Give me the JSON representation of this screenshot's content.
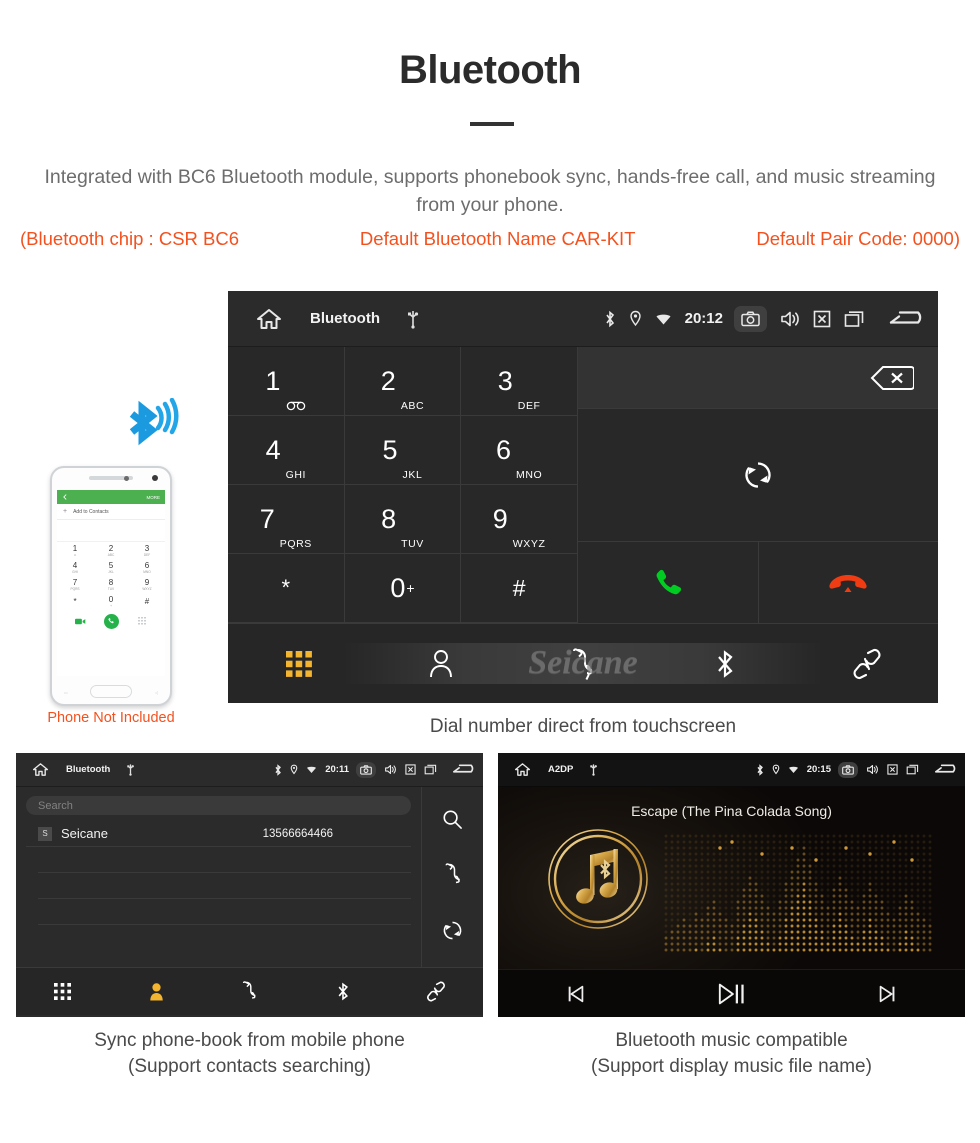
{
  "header": {
    "title": "Bluetooth",
    "description": "Integrated with BC6 Bluetooth module, supports phonebook sync, hands-free call, and music streaming from your phone.",
    "spec_chip": "(Bluetooth chip : CSR BC6",
    "spec_name": "Default Bluetooth Name CAR-KIT",
    "spec_pair": "Default Pair Code: 0000)",
    "accent_color": "#f4511e",
    "text_color": "#6d6d6d"
  },
  "phone_illustration": {
    "note": "Phone Not Included",
    "bluetooth_color": "#1b9ae0",
    "screen": {
      "header_label": "Add to Contacts",
      "more_label": "MORE",
      "plus": "+",
      "keys": [
        {
          "digit": "1",
          "sub": "∞"
        },
        {
          "digit": "2",
          "sub": "ABC"
        },
        {
          "digit": "3",
          "sub": "DEF"
        },
        {
          "digit": "4",
          "sub": "GHI"
        },
        {
          "digit": "5",
          "sub": "JKL"
        },
        {
          "digit": "6",
          "sub": "MNO"
        },
        {
          "digit": "7",
          "sub": "PQRS"
        },
        {
          "digit": "8",
          "sub": "TUV"
        },
        {
          "digit": "9",
          "sub": "WXYZ"
        },
        {
          "digit": "*",
          "sub": ""
        },
        {
          "digit": "0",
          "sub": "+"
        },
        {
          "digit": "#",
          "sub": ""
        }
      ]
    }
  },
  "dialer": {
    "caption": "Dial number direct from touchscreen",
    "statusbar": {
      "title": "Bluetooth",
      "time": "20:12",
      "icons_left": [
        "home-icon",
        "usb-icon"
      ],
      "icons_right": [
        "bluetooth-icon",
        "location-icon",
        "wifi-icon",
        "camera-icon",
        "volume-icon",
        "close-icon",
        "recents-icon",
        "back-icon"
      ]
    },
    "keys": [
      {
        "digit": "1",
        "sub": "",
        "voicemail": true
      },
      {
        "digit": "2",
        "sub": "ABC"
      },
      {
        "digit": "3",
        "sub": "DEF"
      },
      {
        "digit": "4",
        "sub": "GHI"
      },
      {
        "digit": "5",
        "sub": "JKL"
      },
      {
        "digit": "6",
        "sub": "MNO"
      },
      {
        "digit": "7",
        "sub": "PQRS"
      },
      {
        "digit": "8",
        "sub": "TUV"
      },
      {
        "digit": "9",
        "sub": "WXYZ"
      },
      {
        "digit": "*",
        "sub": ""
      },
      {
        "digit": "0",
        "sub": "+"
      },
      {
        "digit": "#",
        "sub": ""
      }
    ],
    "actions": {
      "backspace": "backspace-icon",
      "sync": "sync-icon",
      "call": "call-icon",
      "hangup": "hangup-icon",
      "call_color": "#00cc22",
      "hangup_color": "#f03c13"
    },
    "navbar": {
      "active": "dialpad",
      "items": [
        "dialpad-icon",
        "contacts-icon",
        "callhistory-icon",
        "bluetooth-icon",
        "unlink-icon"
      ],
      "active_color": "#f3b52f"
    },
    "watermark": "Seicane"
  },
  "phonebook": {
    "caption_line1": "Sync phone-book from mobile phone",
    "caption_line2": "(Support contacts searching)",
    "statusbar": {
      "title": "Bluetooth",
      "time": "20:11"
    },
    "search_placeholder": "Search",
    "contacts": [
      {
        "initial": "S",
        "name": "Seicane",
        "number": "13566664466"
      }
    ],
    "empty_rows": 3,
    "side_actions": [
      "search-icon",
      "call-icon",
      "sync-icon"
    ],
    "navbar": {
      "active": "contacts",
      "active_color": "#f3b52f"
    }
  },
  "music": {
    "caption_line1": "Bluetooth music compatible",
    "caption_line2": "(Support display music file name)",
    "statusbar": {
      "title": "A2DP",
      "time": "20:15"
    },
    "track_title": "Escape (The Pina Colada Song)",
    "controls": [
      "previous-icon",
      "play-pause-icon",
      "next-icon"
    ],
    "accent_color": "#d6a03c"
  }
}
